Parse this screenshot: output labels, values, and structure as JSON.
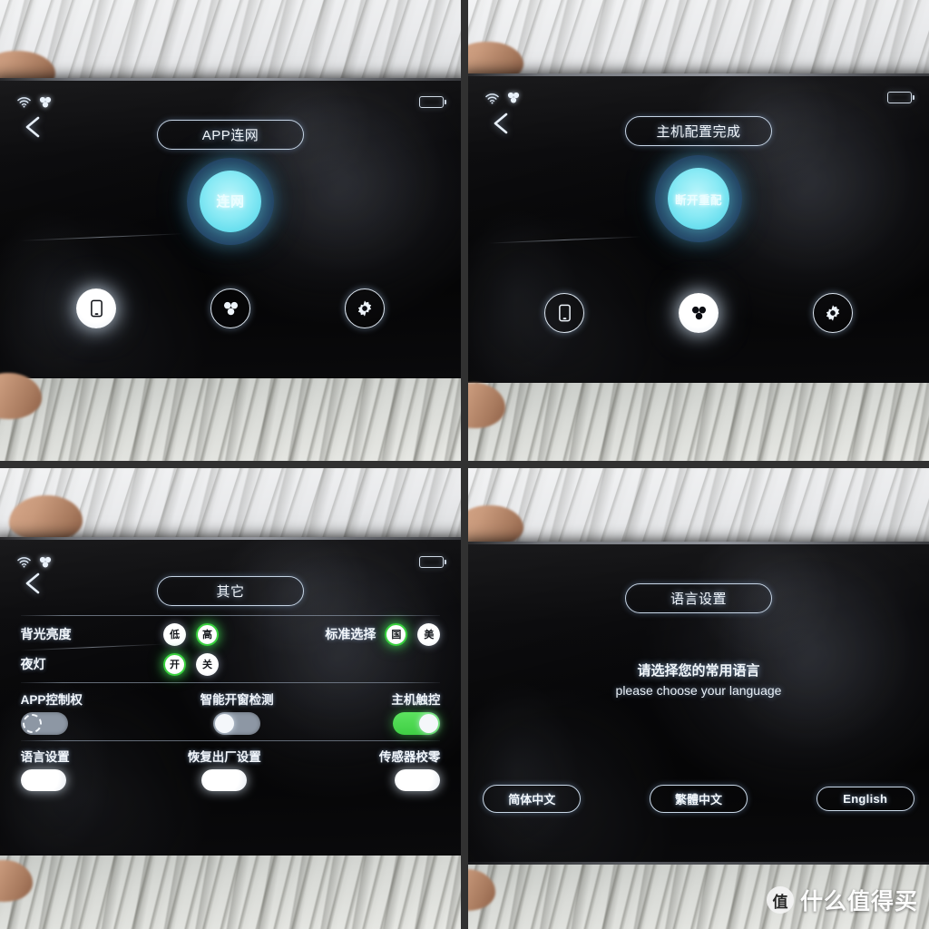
{
  "collage": {
    "panel_count": 4,
    "background_color": "#313131",
    "accent_cyan": "#7ee8f2",
    "accent_green": "#38d13d",
    "screen_black": "#050506"
  },
  "watermark": {
    "badge": "值",
    "text": "什么值得买"
  },
  "status_bar": {
    "wifi_icon": "wifi-icon",
    "cluster_icon": "cluster-icon",
    "battery_icon": "battery-icon"
  },
  "panels": [
    {
      "id": "panel-app-network",
      "title": "APP连网",
      "back_icon": "back-chevron-icon",
      "action_label": "连网",
      "action_state": "idle",
      "nav": [
        {
          "icon": "phone-icon",
          "active": true
        },
        {
          "icon": "cluster-icon",
          "active": false
        },
        {
          "icon": "gear-icon",
          "active": false
        }
      ]
    },
    {
      "id": "panel-host-configured",
      "title": "主机配置完成",
      "back_icon": "back-chevron-icon",
      "action_label": "断开重配",
      "action_state": "connected",
      "nav": [
        {
          "icon": "phone-icon",
          "active": false
        },
        {
          "icon": "cluster-icon",
          "active": true
        },
        {
          "icon": "gear-icon",
          "active": false
        }
      ]
    },
    {
      "id": "panel-other-settings",
      "title": "其它",
      "back_icon": "back-chevron-icon",
      "radio_rows": [
        {
          "label": "背光亮度",
          "options": [
            {
              "text": "低",
              "selected": false
            },
            {
              "text": "高",
              "selected": true
            }
          ],
          "label2": "标准选择",
          "options2": [
            {
              "text": "国",
              "selected": true
            },
            {
              "text": "美",
              "selected": false
            }
          ]
        },
        {
          "label": "夜灯",
          "options": [
            {
              "text": "开",
              "selected": true
            },
            {
              "text": "关",
              "selected": false
            }
          ]
        }
      ],
      "toggles": [
        {
          "label": "APP控制权",
          "state": "pending"
        },
        {
          "label": "智能开窗检测",
          "state": "off"
        },
        {
          "label": "主机触控",
          "state": "on"
        }
      ],
      "action_pills": [
        {
          "label": "语言设置"
        },
        {
          "label": "恢复出厂设置"
        },
        {
          "label": "传感器校零"
        }
      ]
    },
    {
      "id": "panel-language",
      "title": "语言设置",
      "prompt_cn": "请选择您的常用语言",
      "prompt_en": "please choose your language",
      "languages": [
        {
          "label": "简体中文"
        },
        {
          "label": "繁體中文"
        },
        {
          "label": "English"
        }
      ]
    }
  ]
}
